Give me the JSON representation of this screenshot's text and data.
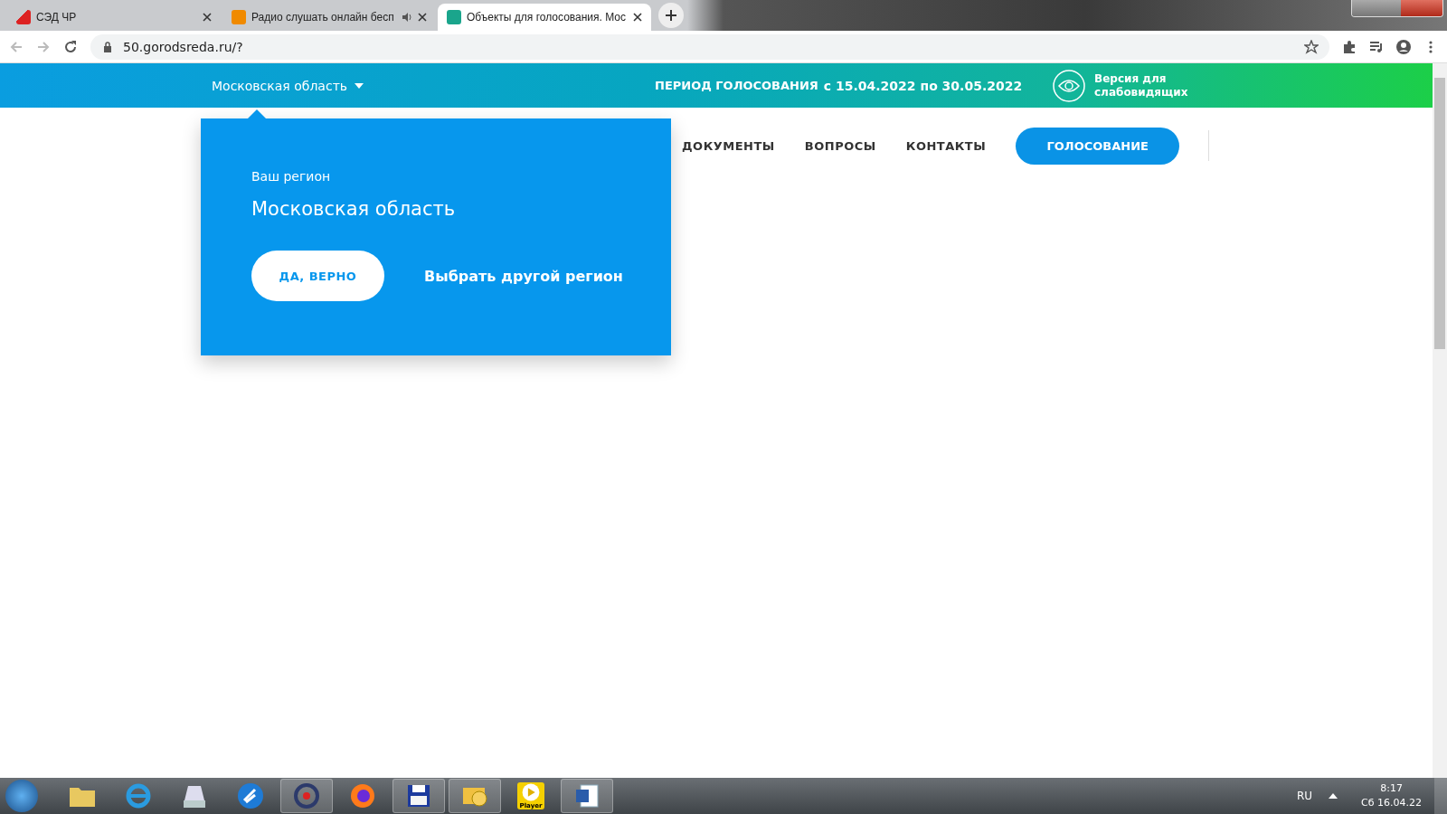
{
  "browser": {
    "tabs": [
      {
        "title": "СЭД ЧР",
        "selected": false,
        "audio": false
      },
      {
        "title": "Радио слушать онлайн бесп",
        "selected": false,
        "audio": true
      },
      {
        "title": "Объекты для голосования. Мос",
        "selected": true,
        "audio": false
      }
    ],
    "url": "50.gorodsreda.ru/?"
  },
  "header": {
    "region": "Московская область",
    "period_label": "ПЕРИОД ГОЛОСОВАНИЯ",
    "period_dates": "с 15.04.2022 по 30.05.2022",
    "accessibility": "Версия для слабовидящих"
  },
  "nav": {
    "items": [
      "ДОКУМЕНТЫ",
      "ВОПРОСЫ",
      "КОНТАКТЫ"
    ],
    "vote_button": "ГОЛОСОВАНИЕ"
  },
  "region_popup": {
    "label": "Ваш регион",
    "region": "Московская область",
    "confirm": "ДА, ВЕРНО",
    "other": "Выбрать другой регион"
  },
  "taskbar": {
    "player_label": "Player",
    "language": "RU",
    "time": "8:17",
    "date": "Сб 16.04.22"
  }
}
